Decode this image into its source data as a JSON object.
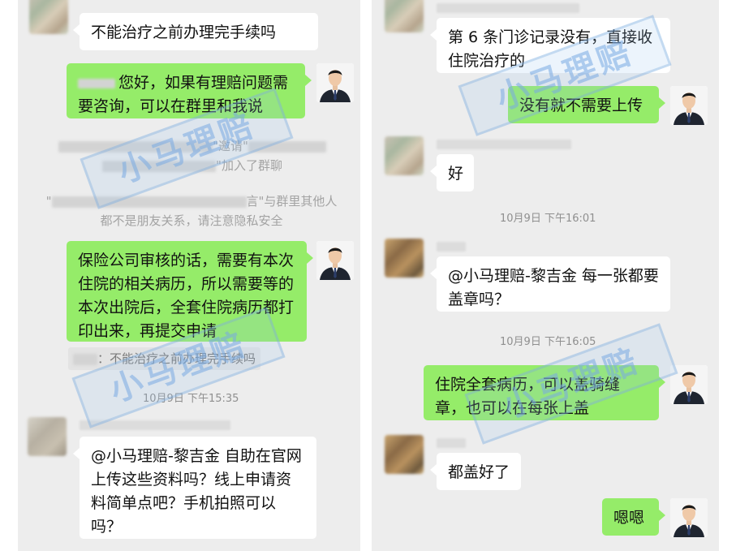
{
  "left": {
    "msg1": "不能治疗之前办理完手续吗",
    "msg2": "您好，如果有理赔问题需要咨询，可以在群里和我说",
    "sys1_mid": "\"邀请\"",
    "sys1_end": "\"加入了群聊",
    "sys2_head": "\"",
    "sys2_tail": "言\"与群里其他人都不是朋友关系，请注意隐私安全",
    "msg3": "保险公司审核的话，需要有本次住院的相关病历，所以需要等的本次出院后，全套住院病历都打印出来，再提交申请",
    "quote": "：不能治疗之前办理完手续吗",
    "time1": "10月9日 下午15:35",
    "msg4": "@小马理赔-黎吉金  自助在官网上传这些资料吗？线上申请资料简单点吧？手机拍照可以吗？"
  },
  "right": {
    "msg1": "第 6 条门诊记录没有，直接收住院治疗的",
    "msg2": "没有就不需要上传",
    "msg3": "好",
    "time1": "10月9日 下午16:01",
    "msg4": "@小马理赔-黎吉金  每一张都要盖章吗？",
    "time2": "10月9日 下午16:05",
    "msg5": "住院全套病历，可以盖骑缝章，也可以在每张上盖",
    "msg6": "都盖好了",
    "msg7": "嗯嗯"
  },
  "watermark": "小马理赔",
  "colors": {
    "bubble_green": "#95ec69",
    "bubble_white": "#ffffff",
    "chat_bg": "#ededed"
  },
  "icons": {
    "agent_avatar": "person-avatar-icon",
    "user_avatar": "blurred-avatar-icon"
  }
}
